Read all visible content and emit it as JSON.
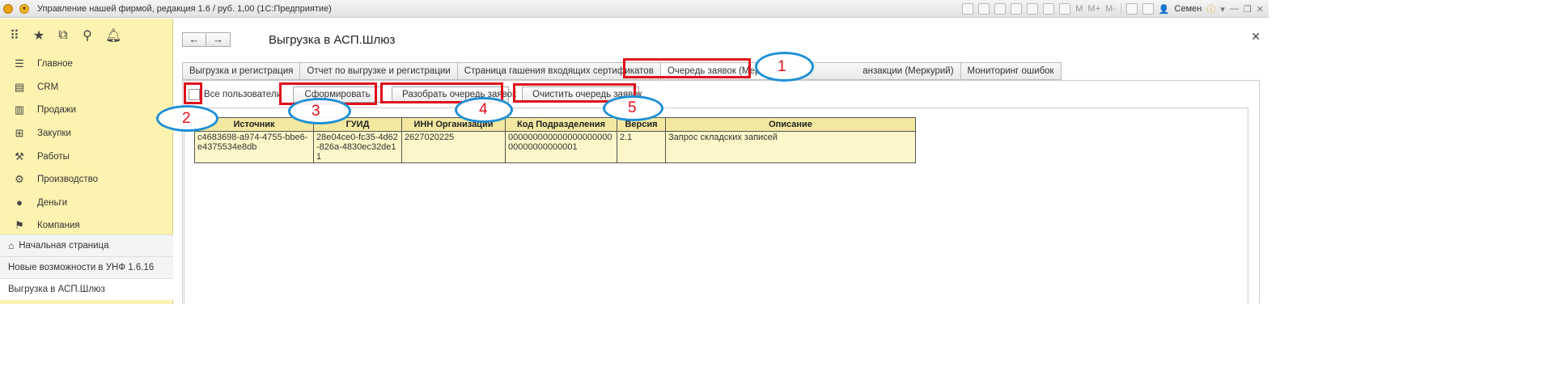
{
  "titlebar": {
    "title": "Управление нашей фирмой, редакция 1.6 / руб. 1,00  (1С:Предприятие)",
    "user": "Семен",
    "memory_labels": [
      "M",
      "M+",
      "M-"
    ]
  },
  "sidebar": {
    "toolbar_icons": [
      "apps-grid-icon",
      "star-icon",
      "history-icon",
      "search-icon",
      "bell-icon"
    ],
    "items": [
      {
        "label": "Главное",
        "icon": "menu-lines-icon"
      },
      {
        "label": "CRM",
        "icon": "crm-icon"
      },
      {
        "label": "Продажи",
        "icon": "cash-register-icon"
      },
      {
        "label": "Закупки",
        "icon": "cart-icon"
      },
      {
        "label": "Работы",
        "icon": "tools-icon"
      },
      {
        "label": "Производство",
        "icon": "gear-icon"
      },
      {
        "label": "Деньги",
        "icon": "coin-icon"
      },
      {
        "label": "Компания",
        "icon": "flag-icon"
      }
    ],
    "lower": [
      {
        "label": "Начальная страница"
      },
      {
        "label": "Новые возможности в УНФ 1.6.16"
      },
      {
        "label": "Выгрузка в АСП.Шлюз"
      }
    ]
  },
  "main": {
    "title": "Выгрузка в АСП.Шлюз",
    "tabs": [
      {
        "label": "Выгрузка и регистрация"
      },
      {
        "label": "Отчет по выгрузке и регистрации"
      },
      {
        "label": "Страница гашения входящих сертификатов"
      },
      {
        "label": "Очередь заявок (Меркурий)"
      },
      {
        "label": "анзакции (Меркурий)"
      },
      {
        "label": "Мониторинг ошибок"
      }
    ],
    "toolbar": {
      "all_users_label": "Все пользователи",
      "form_button": "Сформировать",
      "parse_button": "Разобрать очередь заявок",
      "clear_button": "Очистить очередь заявок"
    },
    "table": {
      "columns": [
        "Источник",
        "ГУИД",
        "ИНН Организации",
        "Код Подразделения",
        "Версия",
        "Описание"
      ],
      "rows": [
        [
          "c4683698-a974-4755-bbe6-e4375534e8db",
          "28e04ce0-fc35-4d62-826a-4830ec32de11",
          "2627020225",
          "00000000000000000000000000000000001",
          "2.1",
          "Запрос складских записей"
        ]
      ]
    }
  },
  "annotations": [
    "1",
    "2",
    "3",
    "4",
    "5"
  ],
  "colors": {
    "sidebar_bg": "#fdf3b0",
    "highlight_box": "#e0101b",
    "callout_ellipse": "#1f8fd6",
    "table_header": "#f2e8a0",
    "table_row": "#fdf6c8"
  }
}
